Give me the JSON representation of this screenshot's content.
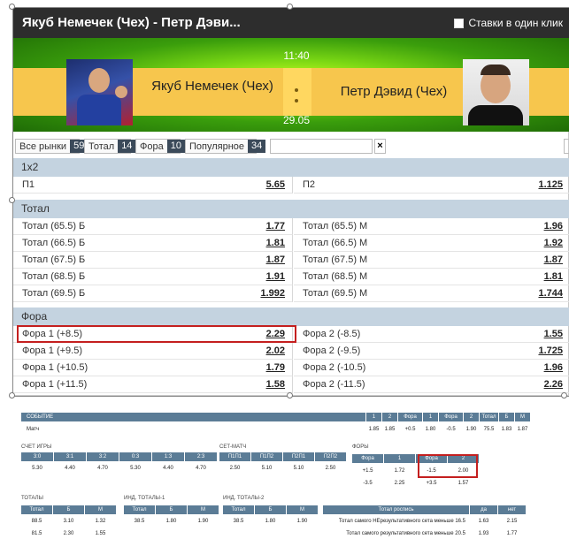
{
  "header": {
    "title": "Якуб Немечек (Чех) - Петр Дэви...",
    "one_click_label": "Ставки в один клик"
  },
  "match": {
    "player1": "Якуб Немечек (Чех)",
    "player2": "Петр Дэвид (Чех)",
    "time": "11:40",
    "date": "29.05"
  },
  "filters": [
    {
      "label": "Все рынки",
      "count": "59"
    },
    {
      "label": "Тотал",
      "count": "14"
    },
    {
      "label": "Фора",
      "count": "10"
    },
    {
      "label": "Популярное",
      "count": "34"
    }
  ],
  "search": {
    "value": "",
    "clear": "×"
  },
  "sections": {
    "s1x2": {
      "title": "1x2",
      "rows": [
        {
          "l": "П1",
          "lo": "5.65",
          "r": "П2",
          "ro": "1.125"
        }
      ]
    },
    "total": {
      "title": "Тотал",
      "rows": [
        {
          "l": "Тотал (65.5) Б",
          "lo": "1.77",
          "r": "Тотал (65.5) М",
          "ro": "1.96"
        },
        {
          "l": "Тотал (66.5) Б",
          "lo": "1.81",
          "r": "Тотал (66.5) М",
          "ro": "1.92"
        },
        {
          "l": "Тотал (67.5) Б",
          "lo": "1.87",
          "r": "Тотал (67.5) М",
          "ro": "1.87"
        },
        {
          "l": "Тотал (68.5) Б",
          "lo": "1.91",
          "r": "Тотал (68.5) М",
          "ro": "1.81"
        },
        {
          "l": "Тотал (69.5) Б",
          "lo": "1.992",
          "r": "Тотал (69.5) М",
          "ro": "1.744"
        }
      ]
    },
    "fora": {
      "title": "Фора",
      "rows": [
        {
          "l": "Фора 1 (+8.5)",
          "lo": "2.29",
          "r": "Фора 2 (-8.5)",
          "ro": "1.55"
        },
        {
          "l": "Фора 1 (+9.5)",
          "lo": "2.02",
          "r": "Фора 2 (-9.5)",
          "ro": "1.725"
        },
        {
          "l": "Фора 1 (+10.5)",
          "lo": "1.79",
          "r": "Фора 2 (-10.5)",
          "ro": "1.96"
        },
        {
          "l": "Фора 1 (+11.5)",
          "lo": "1.58",
          "r": "Фора 2 (-11.5)",
          "ro": "2.26"
        }
      ]
    }
  },
  "lower": {
    "main_head": [
      "СОБЫТИЕ",
      "1",
      "2",
      "Фора",
      "1",
      "Фора",
      "2",
      "Тотал",
      "Б",
      "М"
    ],
    "main_row": [
      "Матч",
      "1.85",
      "1.85",
      "+0.5",
      "1.80",
      "-0.5",
      "1.90",
      "75.5",
      "1.83",
      "1.87"
    ],
    "score_caption": "СЧЕТ ИГРЫ",
    "score_head": [
      "3:0",
      "3:1",
      "3:2",
      "0:3",
      "1:3",
      "2:3"
    ],
    "score_row": [
      "5.30",
      "4.40",
      "4.70",
      "5.30",
      "4.40",
      "4.70"
    ],
    "setmatch_caption": "СЕТ-МАТЧ",
    "setmatch_head": [
      "П1П1",
      "П1П2",
      "П2П1",
      "П2П2"
    ],
    "setmatch_row": [
      "2.50",
      "5.10",
      "5.10",
      "2.50"
    ],
    "fory_caption": "ФОРЫ",
    "fory_head": [
      "Фора",
      "1",
      "Фора",
      "2"
    ],
    "fory_rows": [
      [
        "+1.5",
        "1.72",
        "-1.5",
        "2.00"
      ],
      [
        "-3.5",
        "2.25",
        "+3.5",
        "1.57"
      ]
    ],
    "totals_caption": "ТОТАЛЫ",
    "totals_head": [
      "Тотал",
      "Б",
      "М"
    ],
    "totals_rows": [
      [
        "88.5",
        "3.10",
        "1.32"
      ],
      [
        "81.5",
        "2.30",
        "1.55"
      ]
    ],
    "ind1_caption": "ИНД. ТОТАЛЫ-1",
    "ind1_head": [
      "Тотал",
      "Б",
      "М"
    ],
    "ind1_row": [
      "38.5",
      "1.80",
      "1.90"
    ],
    "ind2_caption": "ИНД. ТОТАЛЫ-2",
    "ind2_head": [
      "Тотал",
      "Б",
      "М"
    ],
    "ind2_row": [
      "38.5",
      "1.80",
      "1.90"
    ],
    "spec_head": [
      "Тотал роспись",
      "да",
      "нет"
    ],
    "spec_rows": [
      [
        "Тотал самого НЕрезультативного сета меньше 16.5",
        "1.63",
        "2.15"
      ],
      [
        "Тотал самого результативного сета меньше 20.5",
        "1.93",
        "1.77"
      ]
    ]
  },
  "colors": {
    "accent_red": "#c41f1f",
    "section_head": "#c4d3e0",
    "table_head": "#5b7c96",
    "titlebar": "#2d2d2d"
  }
}
